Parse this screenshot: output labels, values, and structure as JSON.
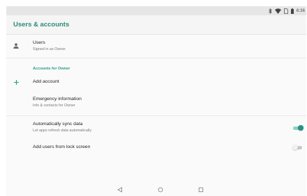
{
  "status_bar": {
    "time": "6:36",
    "icons": [
      "bluetooth-icon",
      "wifi-icon",
      "no-sim-icon",
      "battery-icon"
    ]
  },
  "app_bar": {
    "title": "Users & accounts",
    "title_color": "#2d8a7a"
  },
  "users_row": {
    "icon": "person-icon",
    "title": "Users",
    "subtitle": "Signed in as Owner"
  },
  "accounts_section": {
    "header": "Accounts for Owner",
    "add_account": {
      "icon": "plus-icon",
      "label": "Add account"
    }
  },
  "emergency_row": {
    "title": "Emergency information",
    "subtitle": "Info & contacts for Owner"
  },
  "sync_row": {
    "title": "Automatically sync data",
    "subtitle": "Let apps refresh data automatically",
    "enabled": true
  },
  "lock_screen_row": {
    "title": "Add users from lock screen",
    "enabled": false
  },
  "nav_bar": {
    "buttons": [
      "back-icon",
      "home-icon",
      "recents-icon"
    ]
  },
  "colors": {
    "accent": "#22937f",
    "section_header": "#2a9a86"
  }
}
